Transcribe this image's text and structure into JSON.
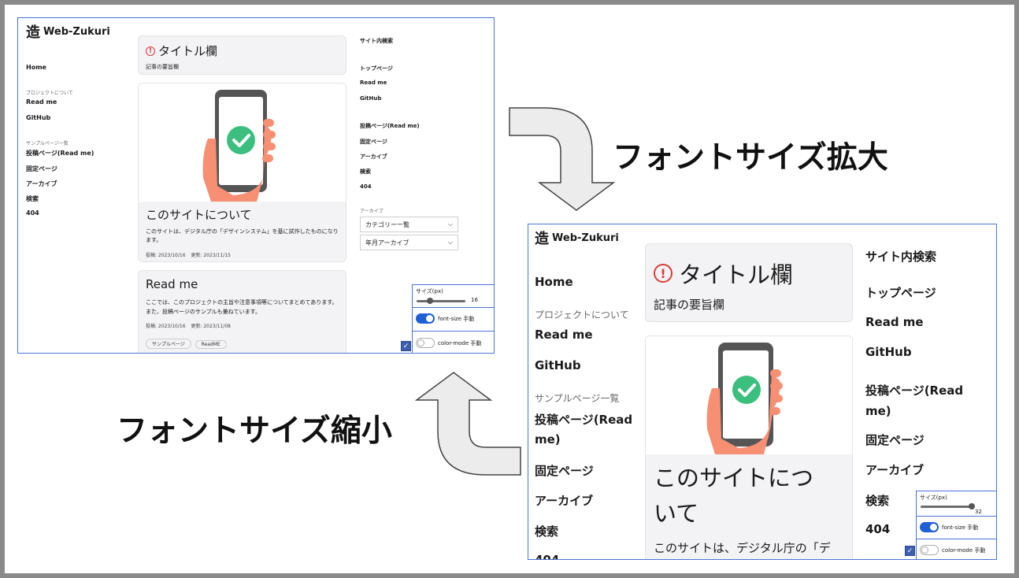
{
  "captions": {
    "enlarge": "フォントサイズ拡大",
    "shrink": "フォントサイズ縮小"
  },
  "site": {
    "logo_kanji": "造",
    "logo_text": "Web-Zukuri",
    "nav": {
      "home": "Home",
      "project_cat": "プロジェクトについて",
      "readme": "Read me",
      "github": "GitHub",
      "sample_cat": "サンプルページ一覧",
      "post_page": "投稿ページ(Read me)",
      "post_page_a": "投稿ページ(Read",
      "post_page_b": "me)",
      "fixed_page": "固定ページ",
      "archive": "アーカイブ",
      "search": "検索",
      "notfound": "404"
    },
    "title_card": {
      "title": "タイトル欄",
      "summary": "記事の要旨欄"
    },
    "about_card": {
      "heading": "このサイトについて",
      "heading_a": "このサイトにつ",
      "heading_b": "いて",
      "body": "このサイトは、デジタル庁の「デザインシステム」を基に試作したものになります。",
      "body_cut": "このサイトは、デジタル庁の「デ",
      "posted": "投稿: 2023/10/16",
      "updated": "更新: 2023/11/15"
    },
    "readme_card": {
      "heading": "Read me",
      "body": "ここでは、このプロジェクトの主旨や注意事項等についてまとめてあります。また、投稿ページのサンプルも兼ねています。",
      "posted": "投稿: 2023/10/16",
      "updated": "更新: 2023/11/08",
      "tags": [
        "サンプルページ",
        "ReadME"
      ]
    },
    "right": {
      "search": "サイト内検索",
      "top": "トップページ",
      "readme": "Read me",
      "github": "GitHub",
      "post_page": "投稿ページ(Read me)",
      "post_page_a": "投稿ページ(Read",
      "post_page_b": "me)",
      "fixed_page": "固定ページ",
      "archive": "アーカイブ",
      "search2": "検索",
      "notfound": "404",
      "archive_label": "アーカイブ",
      "category_select": "カテゴリー一覧",
      "month_select": "年月アーカイブ"
    },
    "panel": {
      "size_label": "サイズ(px)",
      "size_small": "16",
      "size_large": "32",
      "font_toggle": "font-size 手動",
      "color_toggle": "color-mode 手動"
    }
  },
  "colors": {
    "accent_blue": "#1f5fd6",
    "border_blue": "#4a73d9",
    "warn_red": "#e03a3a",
    "check_green": "#3cbf7e",
    "hand": "#f78f73"
  }
}
